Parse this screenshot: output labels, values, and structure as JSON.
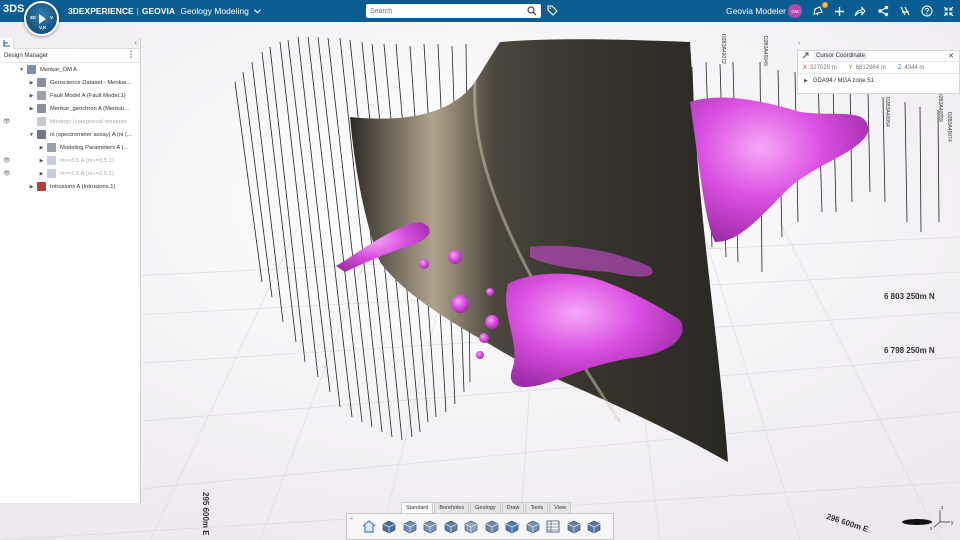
{
  "topbar": {
    "brand_logo": "3DS",
    "compass_top": "3D",
    "compass_left": "3D",
    "compass_right": "V",
    "compass_bottom": "V,R",
    "title_brand": "3DEXPERIENCE",
    "title_sep": "|",
    "title_product": "GEOVIA",
    "title_app": "Geology Modeling",
    "search_placeholder": "Search",
    "user_name": "Geovia Modeler",
    "user_initials": "GM",
    "notification_count": "4"
  },
  "design_manager": {
    "title": "Design Manager",
    "items": [
      {
        "label": "Menkar_OM A",
        "level": 0,
        "expand": "▼",
        "eye": "",
        "color": "#7a8fa8",
        "dim": false
      },
      {
        "label": "Geoscience Dataset - Menkar...",
        "level": 1,
        "expand": "▶",
        "eye": "",
        "color": "#8a8f99",
        "dim": false
      },
      {
        "label": "Fault Model A (Fault Model.1)",
        "level": 1,
        "expand": "▶",
        "eye": "",
        "color": "#9aa0aa",
        "dim": false
      },
      {
        "label": "Menkar_geochron A (Menkar...",
        "level": 1,
        "expand": "▶",
        "eye": "",
        "color": "#8a8f99",
        "dim": false
      },
      {
        "label": "lithology (categorical measure",
        "level": 1,
        "expand": "",
        "eye": "👁",
        "color": "#c8c8d0",
        "dim": true
      },
      {
        "label": "ni (spectrometer assay) A (ni (...",
        "level": 1,
        "expand": "▼",
        "eye": "",
        "color": "#707888",
        "dim": false
      },
      {
        "label": "Modeling Parameters A (...",
        "level": 2,
        "expand": "▶",
        "eye": "",
        "color": "#9aa0aa",
        "dim": false
      },
      {
        "label": "ni>=3.5 A (ni>=3.5.1)",
        "level": 2,
        "expand": "▶",
        "eye": "👁",
        "color": "#c8cce0",
        "dim": true
      },
      {
        "label": "ni>=2.5 A (ni>=2.5.1)",
        "level": 2,
        "expand": "▶",
        "eye": "👁",
        "color": "#c8cce0",
        "dim": true
      },
      {
        "label": "Intrusions A (Intrusions.1)",
        "level": 1,
        "expand": "▶",
        "eye": "",
        "color": "#b04040",
        "dim": false
      }
    ]
  },
  "cursor_coordinate": {
    "title": "Cursor Coordinate",
    "x_key": "X",
    "x_value": "327025 m",
    "y_key": "Y",
    "y_value": "6812964 m",
    "z_key": "Z",
    "z_value": "4344 m",
    "system": "GDA94 / MGA zone 51"
  },
  "scene_labels": {
    "northing_1": "6 803 250m N",
    "northing_2": "6 798 250m N",
    "easting_1": "295 600m E",
    "easting_2": "296 600m E",
    "drillhole_1": "D2B3A40072",
    "drillhole_2": "D2B3A40049",
    "drillhole_3": "D2B3A40054",
    "drillhole_4": "D2B3A40059",
    "drillhole_5": "D2B3A40074"
  },
  "action_bar": {
    "tabs": [
      "Standard",
      "Boreholes",
      "Geology",
      "Draw",
      "Tools",
      "View"
    ],
    "active_tab": "Standard",
    "tools": [
      "home-icon",
      "surface-icon",
      "block-model-icon",
      "layers-icon",
      "section-icon",
      "grid-icon",
      "solid-icon",
      "solid-blue-icon",
      "mesh-icon",
      "table-icon",
      "filter-icon",
      "package-icon"
    ]
  },
  "axis": {
    "x": "x",
    "y": "y",
    "z": "z"
  },
  "colors": {
    "topbar": "#0a5d93",
    "orebody": "#d94fe0",
    "fault_surface": "#3a3830",
    "accent_red": "#c0392b"
  }
}
